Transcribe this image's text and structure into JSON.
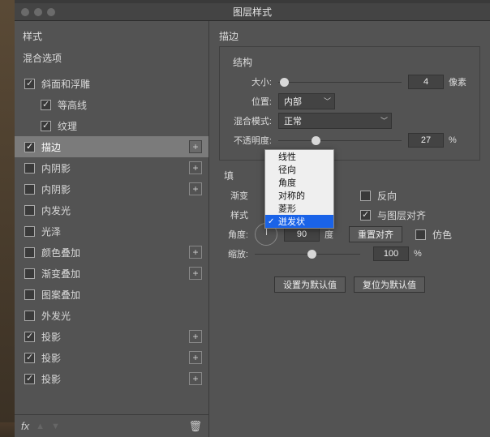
{
  "window": {
    "title": "图层样式"
  },
  "left": {
    "styles_header": "样式",
    "blend_options": "混合选项",
    "effects": [
      {
        "label": "斜面和浮雕",
        "checked": true,
        "indent": 0,
        "plus": false
      },
      {
        "label": "等高线",
        "checked": true,
        "indent": 1,
        "plus": false
      },
      {
        "label": "纹理",
        "checked": true,
        "indent": 1,
        "plus": false
      },
      {
        "label": "描边",
        "checked": true,
        "indent": 0,
        "plus": true,
        "selected": true
      },
      {
        "label": "内阴影",
        "checked": false,
        "indent": 0,
        "plus": true
      },
      {
        "label": "内阴影",
        "checked": false,
        "indent": 0,
        "plus": true
      },
      {
        "label": "内发光",
        "checked": false,
        "indent": 0,
        "plus": false
      },
      {
        "label": "光泽",
        "checked": false,
        "indent": 0,
        "plus": false
      },
      {
        "label": "颜色叠加",
        "checked": false,
        "indent": 0,
        "plus": true
      },
      {
        "label": "渐变叠加",
        "checked": false,
        "indent": 0,
        "plus": true
      },
      {
        "label": "图案叠加",
        "checked": false,
        "indent": 0,
        "plus": false
      },
      {
        "label": "外发光",
        "checked": false,
        "indent": 0,
        "plus": false
      },
      {
        "label": "投影",
        "checked": true,
        "indent": 0,
        "plus": true
      },
      {
        "label": "投影",
        "checked": true,
        "indent": 0,
        "plus": true
      },
      {
        "label": "投影",
        "checked": true,
        "indent": 0,
        "plus": true
      }
    ],
    "fx_label": "fx"
  },
  "right": {
    "panel_title": "描边",
    "structure_label": "结构",
    "size_label": "大小:",
    "size_value": "4",
    "size_unit": "像素",
    "position_label": "位置:",
    "position_value": "内部",
    "blend_mode_label": "混合模式:",
    "blend_mode_value": "正常",
    "opacity_label": "不透明度:",
    "opacity_value": "27",
    "opacity_unit": "%",
    "fill_label": "填",
    "gradient_label": "渐变",
    "reverse_label": "反向",
    "style_label": "样式",
    "align_label": "与图层对齐",
    "angle_label": "角度:",
    "angle_value": "90",
    "angle_unit": "度",
    "reset_align": "重置对齐",
    "dither_label": "仿色",
    "scale_label": "缩放:",
    "scale_value": "100",
    "scale_unit": "%",
    "make_default": "设置为默认值",
    "reset_default": "复位为默认值"
  },
  "dropdown": {
    "items": [
      {
        "label": "线性"
      },
      {
        "label": "径向"
      },
      {
        "label": "角度"
      },
      {
        "label": "对称的"
      },
      {
        "label": "菱形"
      },
      {
        "label": "迸发状",
        "selected": true,
        "checked": true
      }
    ]
  }
}
